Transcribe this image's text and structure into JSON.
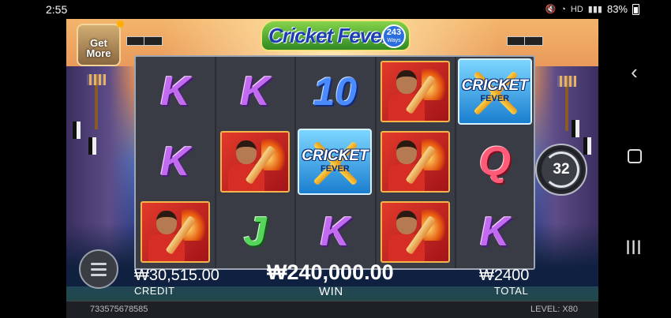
{
  "status_bar": {
    "time": "2:55",
    "battery": "83%",
    "hd_label": "HD Voice"
  },
  "game": {
    "title": "Cricket Fever",
    "ways_number": "243",
    "ways_label": "Ways",
    "get_more_label": "Get More",
    "spin_count": "32",
    "credit": {
      "value": "₩30,515.00",
      "label": "CREDIT"
    },
    "win": {
      "value": "₩240,000.00",
      "label": "WIN"
    },
    "total": {
      "value": "₩2400",
      "label": "TOTAL"
    },
    "player_id": "733575678585",
    "level": {
      "label": "LEVEL:",
      "value": "X80"
    },
    "wild_text": {
      "line1": "CRICKET",
      "line2": "FEVER"
    },
    "reels": [
      [
        "K",
        "K",
        "player"
      ],
      [
        "K",
        "player",
        "J"
      ],
      [
        "10",
        "wild",
        "K"
      ],
      [
        "player",
        "player",
        "player"
      ],
      [
        "wild",
        "Q",
        "K"
      ]
    ]
  }
}
